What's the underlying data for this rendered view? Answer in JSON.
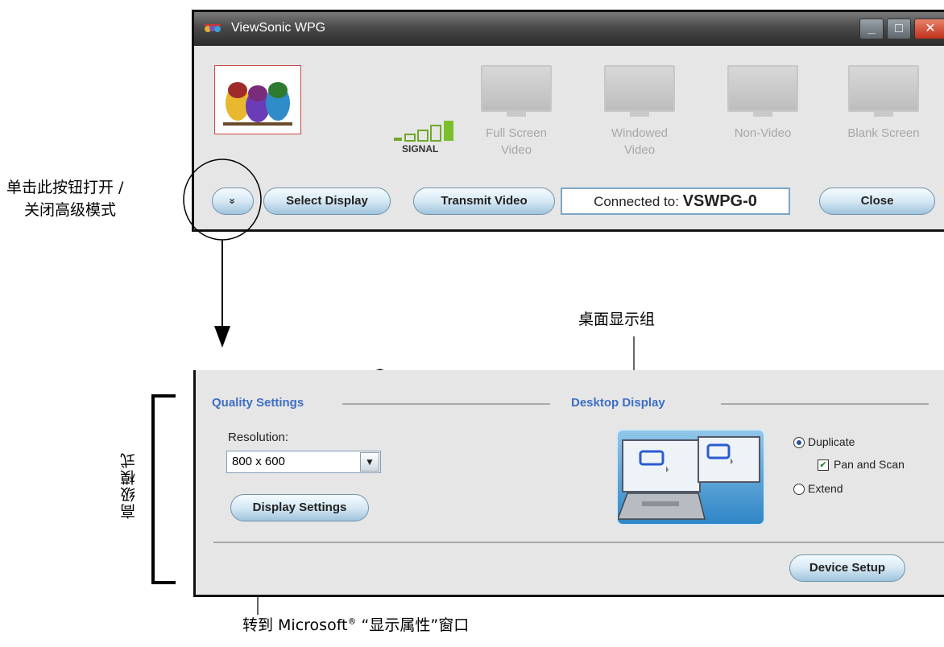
{
  "window": {
    "title": "ViewSonic WPG",
    "controls": {
      "minimize": "_",
      "maximize": "□",
      "close": "✕"
    }
  },
  "signal": {
    "label": "SIGNAL",
    "bars": 5
  },
  "modes": [
    {
      "line1": "Full Screen",
      "line2": "Video"
    },
    {
      "line1": "Windowed",
      "line2": "Video"
    },
    {
      "line1": "Non-Video",
      "line2": ""
    },
    {
      "line1": "Blank Screen",
      "line2": ""
    }
  ],
  "toolbar": {
    "toggle_icon": "»",
    "select_display": "Select Display",
    "transmit_video": "Transmit Video",
    "connected_prefix": "Connected to: ",
    "connected_device": "VSWPG-0",
    "close": "Close"
  },
  "annotations": {
    "toggle_note_line1": "单击此按钮打开 /",
    "toggle_note_line2": "关闭高级模式",
    "desktop_group": "桌面显示组",
    "advanced_mode": "高级模式",
    "display_settings_note_pre": "转到 Microsoft",
    "display_settings_note_reg": "®",
    "display_settings_note_post": " “显示属性”窗口"
  },
  "advanced": {
    "quality_title": "Quality Settings",
    "desktop_title": "Desktop Display",
    "resolution_label": "Resolution:",
    "resolution_value": "800 x 600",
    "display_settings": "Display Settings",
    "device_setup": "Device Setup",
    "options": {
      "duplicate": "Duplicate",
      "pan_and_scan": "Pan and Scan",
      "extend": "Extend"
    },
    "duplicate_selected": true,
    "pan_and_scan_checked": true
  },
  "colors": {
    "accent_blue": "#3e6ec4",
    "button_blue": "#d6e8f4",
    "title_bar": "#3a3a3a",
    "close_red": "#c0311b"
  }
}
